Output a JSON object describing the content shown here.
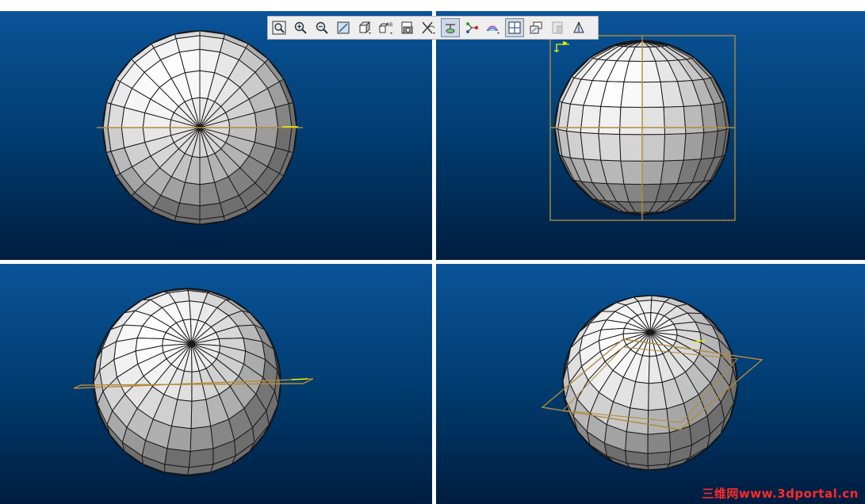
{
  "app": {
    "layout": "four-viewport",
    "viewports": [
      {
        "id": "top-left",
        "view": "top"
      },
      {
        "id": "top-right",
        "view": "front"
      },
      {
        "id": "bottom-left",
        "view": "tilted"
      },
      {
        "id": "bottom-right",
        "view": "isometric"
      }
    ]
  },
  "toolbar": {
    "buttons": [
      {
        "name": "zoom-fit-button",
        "icon": "zoom-fit-icon",
        "active": false
      },
      {
        "name": "zoom-in-button",
        "icon": "zoom-in-icon",
        "active": false
      },
      {
        "name": "zoom-out-button",
        "icon": "zoom-out-icon",
        "active": false
      },
      {
        "name": "normal-view-button",
        "icon": "normal-view-icon",
        "active": false
      },
      {
        "name": "view-orientation-button",
        "icon": "cube-icon",
        "active": false
      },
      {
        "name": "named-views-button",
        "icon": "named-views-icon",
        "active": false
      },
      {
        "name": "capture-image-button",
        "icon": "camera-icon",
        "active": false
      },
      {
        "name": "hide-show-button",
        "icon": "hide-show-icon",
        "active": false
      },
      {
        "name": "swap-visible-space-button",
        "icon": "swap-space-icon",
        "active": true
      },
      {
        "name": "sketch-constraints-button",
        "icon": "node-link-icon",
        "active": false
      },
      {
        "name": "render-styles-button",
        "icon": "render-style-icon",
        "active": false
      },
      {
        "name": "split-view-button",
        "icon": "split-view-icon",
        "active": true
      },
      {
        "name": "multi-view-button",
        "icon": "multi-view-icon",
        "active": false
      },
      {
        "name": "display-mode-button",
        "icon": "display-mode-icon",
        "active": false
      },
      {
        "name": "section-view-button",
        "icon": "section-view-icon",
        "active": false
      }
    ]
  },
  "colors": {
    "viewport_top": "#0a5499",
    "viewport_bottom": "#001d40",
    "sphere_light": "#ffffff",
    "sphere_dark": "#7a7a7a",
    "mesh_line": "#1a1a1a",
    "plane": "#b08a3a",
    "axis_label": "#f2f200",
    "watermark": "#ff2a2a"
  },
  "watermark": {
    "text": "三维网www.3dportal.cn"
  }
}
